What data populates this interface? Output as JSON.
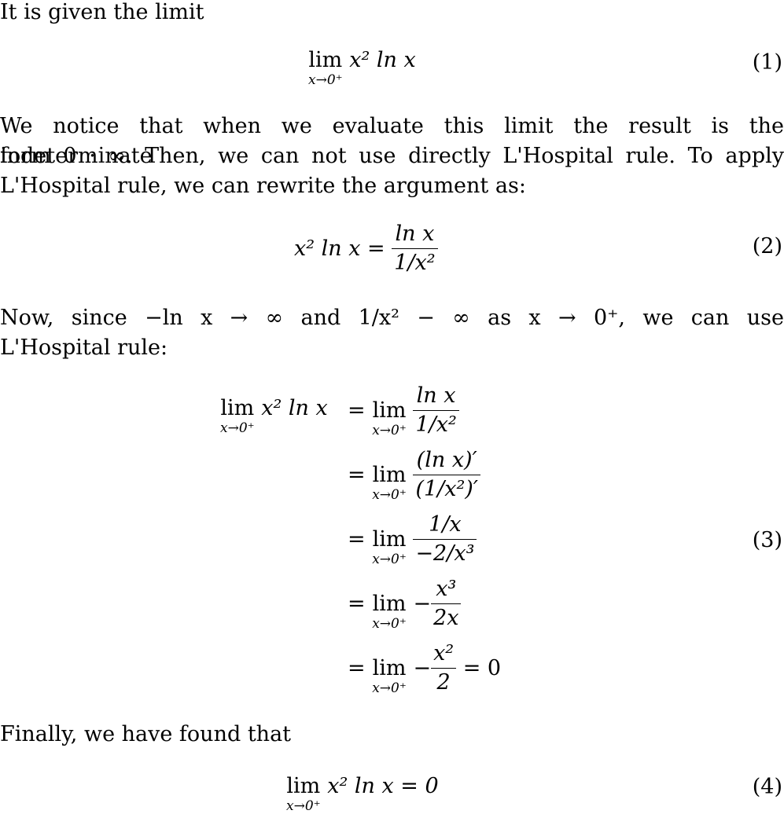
{
  "intro": "It is given the limit",
  "eq1": {
    "lim": "lim",
    "sub": "x→0⁺",
    "expr": "x² ln x",
    "num": "(1)"
  },
  "para2": {
    "line1": "We notice that when we evaluate this limit the result is the indeterminate",
    "line2": "form 0 · ∞.  Then, we can not use directly L'Hospital rule.  To apply",
    "line3": "L'Hospital rule, we can rewrite the argument as:"
  },
  "eq2": {
    "lhs": "x² ln x =",
    "num_top": "ln x",
    "den": "1/x²",
    "num": "(2)"
  },
  "para3": {
    "line1": "Now, since −ln x → ∞   and   1/x² − ∞   as   x → 0⁺, we can use",
    "line2": "L'Hospital rule:"
  },
  "eq3": {
    "lim": "lim",
    "sub": "x→0⁺",
    "lhs_expr": "x² ln x",
    "num": "(3)",
    "rows": [
      {
        "op": "=",
        "top": "ln x",
        "bottom": "1/x²",
        "tail": ""
      },
      {
        "op": "=",
        "top": "(ln x)′",
        "bottom": "(1/x²)′",
        "tail": ""
      },
      {
        "op": "=",
        "top": "1/x",
        "bottom": "−2/x³",
        "tail": ""
      },
      {
        "op": "= ",
        "prefix": "−",
        "top": "x³",
        "bottom": "2x",
        "tail": ""
      },
      {
        "op": "=",
        "prefix": "−",
        "top": "x²",
        "bottom": "2",
        "tail": "= 0"
      }
    ]
  },
  "para4": "Finally, we have found that",
  "eq4": {
    "lim": "lim",
    "sub": "x→0⁺",
    "expr": "x² ln x = 0",
    "num": "(4)"
  }
}
